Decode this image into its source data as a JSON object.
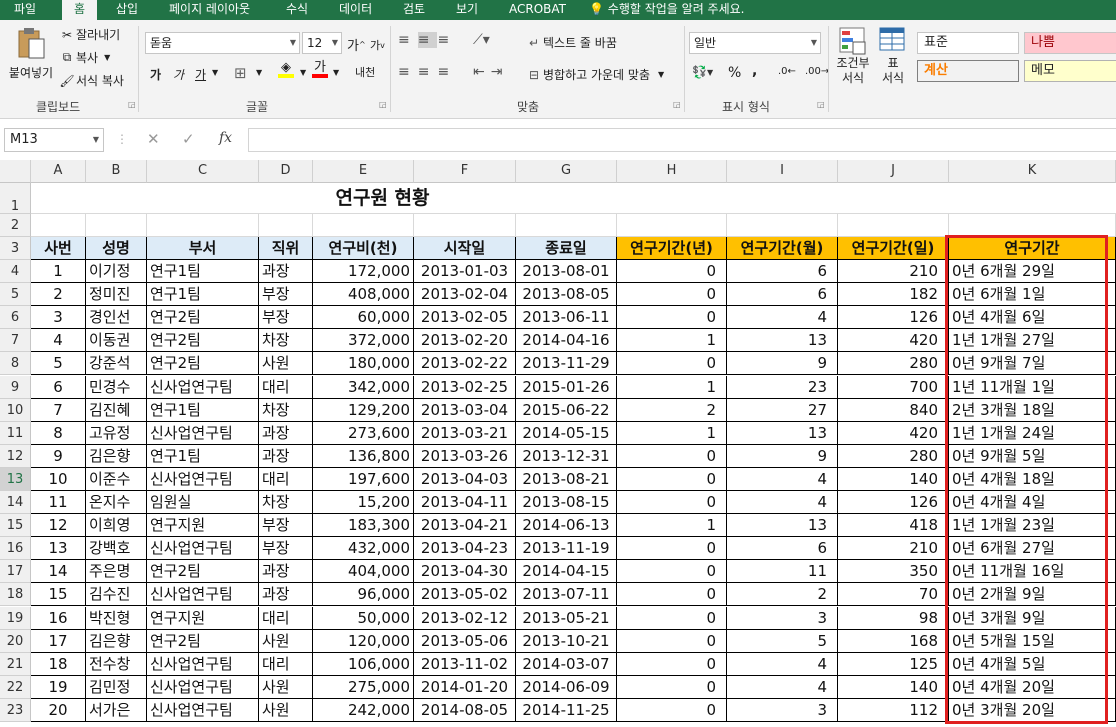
{
  "tabs": [
    "파일",
    "홈",
    "삽입",
    "페이지 레이아웃",
    "수식",
    "데이터",
    "검토",
    "보기",
    "ACROBAT"
  ],
  "tell_me": "수행할 작업을 알려 주세요.",
  "ribbon": {
    "clipboard": {
      "paste": "붙여넣기",
      "cut": "잘라내기",
      "copy": "복사",
      "format_painter": "서식 복사",
      "label": "클립보드"
    },
    "font": {
      "name": "돋움",
      "size": "12",
      "bold": "가",
      "italic": "가",
      "underline": "가",
      "label": "글꼴"
    },
    "align": {
      "wrap": "텍스트 줄 바꿈",
      "merge": "병합하고 가운데 맞춤",
      "label": "맞춤"
    },
    "number": {
      "format": "일반",
      "percent": "%",
      "comma": ",",
      "label": "표시 형식"
    },
    "styles": {
      "cond": "조건부",
      "cond2": "서식",
      "table": "표",
      "table2": "서식",
      "normal": "표준",
      "bad": "나쁨",
      "calc": "계산",
      "memo": "메모"
    }
  },
  "formula_bar": {
    "name_box": "M13",
    "fx": "fx",
    "value": ""
  },
  "colors": {
    "excel_green": "#217346",
    "header_blue": "#ddebf7",
    "header_orange": "#ffc000",
    "highlight_red": "#e02020"
  },
  "columns": [
    "A",
    "B",
    "C",
    "D",
    "E",
    "F",
    "G",
    "H",
    "I",
    "J",
    "K"
  ],
  "rows": [
    "1",
    "2",
    "3",
    "4",
    "5",
    "6",
    "7",
    "8",
    "9",
    "10",
    "11",
    "12",
    "13",
    "14",
    "15",
    "16",
    "17",
    "18",
    "19",
    "20",
    "21",
    "22",
    "23"
  ],
  "selected_row": "13",
  "sheet_title": "연구원 현황",
  "headers": [
    "사번",
    "성명",
    "부서",
    "직위",
    "연구비(천)",
    "시작일",
    "종료일",
    "연구기간(년)",
    "연구기간(월)",
    "연구기간(일)",
    "연구기간"
  ],
  "data": [
    [
      "1",
      "이기정",
      "연구1팀",
      "과장",
      "172,000",
      "2013-01-03",
      "2013-08-01",
      "0",
      "6",
      "210",
      "0년 6개월 29일"
    ],
    [
      "2",
      "정미진",
      "연구1팀",
      "부장",
      "408,000",
      "2013-02-04",
      "2013-08-05",
      "0",
      "6",
      "182",
      "0년 6개월 1일"
    ],
    [
      "3",
      "경인선",
      "연구2팀",
      "부장",
      "60,000",
      "2013-02-05",
      "2013-06-11",
      "0",
      "4",
      "126",
      "0년 4개월 6일"
    ],
    [
      "4",
      "이동권",
      "연구2팀",
      "차장",
      "372,000",
      "2013-02-20",
      "2014-04-16",
      "1",
      "13",
      "420",
      "1년 1개월 27일"
    ],
    [
      "5",
      "강준석",
      "연구2팀",
      "사원",
      "180,000",
      "2013-02-22",
      "2013-11-29",
      "0",
      "9",
      "280",
      "0년 9개월 7일"
    ],
    [
      "6",
      "민경수",
      "신사업연구팀",
      "대리",
      "342,000",
      "2013-02-25",
      "2015-01-26",
      "1",
      "23",
      "700",
      "1년 11개월 1일"
    ],
    [
      "7",
      "김진혜",
      "연구1팀",
      "차장",
      "129,200",
      "2013-03-04",
      "2015-06-22",
      "2",
      "27",
      "840",
      "2년 3개월 18일"
    ],
    [
      "8",
      "고유정",
      "신사업연구팀",
      "과장",
      "273,600",
      "2013-03-21",
      "2014-05-15",
      "1",
      "13",
      "420",
      "1년 1개월 24일"
    ],
    [
      "9",
      "김은향",
      "연구1팀",
      "과장",
      "136,800",
      "2013-03-26",
      "2013-12-31",
      "0",
      "9",
      "280",
      "0년 9개월 5일"
    ],
    [
      "10",
      "이준수",
      "신사업연구팀",
      "대리",
      "197,600",
      "2013-04-03",
      "2013-08-21",
      "0",
      "4",
      "140",
      "0년 4개월 18일"
    ],
    [
      "11",
      "온지수",
      "임원실",
      "차장",
      "15,200",
      "2013-04-11",
      "2013-08-15",
      "0",
      "4",
      "126",
      "0년 4개월 4일"
    ],
    [
      "12",
      "이희영",
      "연구지원",
      "부장",
      "183,300",
      "2013-04-21",
      "2014-06-13",
      "1",
      "13",
      "418",
      "1년 1개월 23일"
    ],
    [
      "13",
      "강백호",
      "신사업연구팀",
      "부장",
      "432,000",
      "2013-04-23",
      "2013-11-19",
      "0",
      "6",
      "210",
      "0년 6개월 27일"
    ],
    [
      "14",
      "주은명",
      "연구2팀",
      "과장",
      "404,000",
      "2013-04-30",
      "2014-04-15",
      "0",
      "11",
      "350",
      "0년 11개월 16일"
    ],
    [
      "15",
      "김수진",
      "신사업연구팀",
      "과장",
      "96,000",
      "2013-05-02",
      "2013-07-11",
      "0",
      "2",
      "70",
      "0년 2개월 9일"
    ],
    [
      "16",
      "박진형",
      "연구지원",
      "대리",
      "50,000",
      "2013-02-12",
      "2013-05-21",
      "0",
      "3",
      "98",
      "0년 3개월 9일"
    ],
    [
      "17",
      "김은향",
      "연구2팀",
      "사원",
      "120,000",
      "2013-05-06",
      "2013-10-21",
      "0",
      "5",
      "168",
      "0년 5개월 15일"
    ],
    [
      "18",
      "전수창",
      "신사업연구팀",
      "대리",
      "106,000",
      "2013-11-02",
      "2014-03-07",
      "0",
      "4",
      "125",
      "0년 4개월 5일"
    ],
    [
      "19",
      "김민정",
      "신사업연구팀",
      "사원",
      "275,000",
      "2014-01-20",
      "2014-06-09",
      "0",
      "4",
      "140",
      "0년 4개월 20일"
    ],
    [
      "20",
      "서가은",
      "신사업연구팀",
      "사원",
      "242,000",
      "2014-08-05",
      "2014-11-25",
      "0",
      "3",
      "112",
      "0년 3개월 20일"
    ]
  ]
}
